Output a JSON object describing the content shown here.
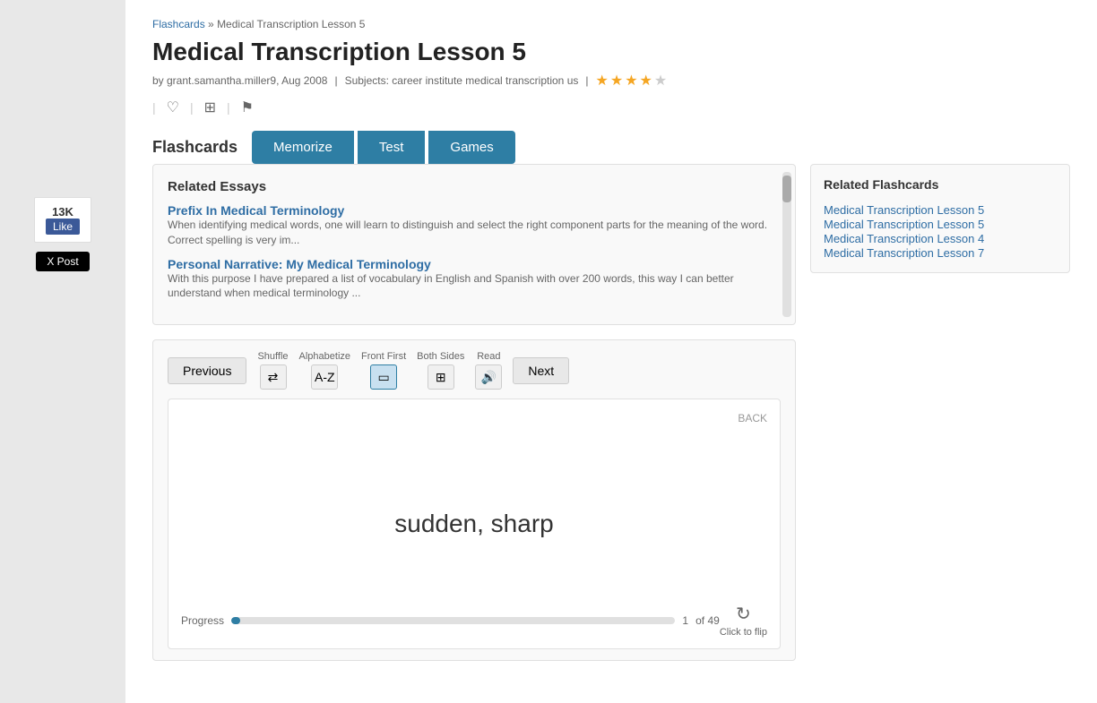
{
  "breadcrumb": {
    "home": "Flashcards",
    "separator": "»",
    "current": "Medical Transcription Lesson 5"
  },
  "title": "Medical Transcription Lesson 5",
  "meta": {
    "author": "by grant.samantha.miller9, Aug 2008",
    "subjects_label": "Subjects: career institute medical transcription us",
    "rating": 3.5,
    "stars": [
      true,
      true,
      true,
      true,
      false
    ]
  },
  "tabs": {
    "flashcards": "Flashcards",
    "memorize": "Memorize",
    "test": "Test",
    "games": "Games"
  },
  "related_flashcards": {
    "title": "Related Flashcards",
    "items": [
      "Medical Transcription Lesson 5",
      "Medical Transcription Lesson 5",
      "Medical Transcription Lesson 4",
      "Medical Transcription Lesson 7"
    ]
  },
  "related_essays": {
    "title": "Related Essays",
    "items": [
      {
        "title": "Prefix In Medical Terminology",
        "excerpt": "When identifying medical words, one will learn to distinguish and select the right component parts for the meaning of the word. Correct spelling is very im..."
      },
      {
        "title": "Personal Narrative: My Medical Terminology",
        "excerpt": "With this purpose I have prepared a list of vocabulary in English and Spanish with over 200 words, this way I can better understand when medical terminology ..."
      }
    ]
  },
  "flashcard": {
    "back_label": "BACK",
    "card_text": "sudden, sharp",
    "progress_label": "Progress",
    "progress_current": "1",
    "progress_of": "of 49",
    "progress_percent": 2,
    "flip_label": "Click to flip"
  },
  "controls": {
    "previous": "Previous",
    "next": "Next",
    "shuffle_label": "Shuffle",
    "alphabetize_label": "Alphabetize",
    "front_first_label": "Front First",
    "both_sides_label": "Both Sides",
    "read_label": "Read"
  },
  "social": {
    "fb_count": "13K",
    "fb_label": "Like",
    "x_post": "X Post"
  }
}
